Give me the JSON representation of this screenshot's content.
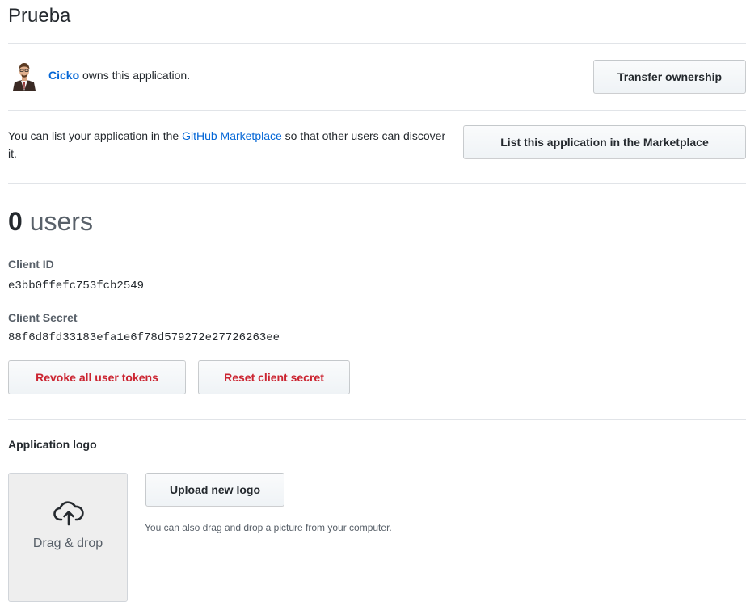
{
  "app": {
    "title": "Prueba"
  },
  "owner": {
    "name": "Cicko",
    "suffix": " owns this application.",
    "transfer_button": "Transfer ownership"
  },
  "marketplace": {
    "text_before": "You can list your application in the ",
    "link_text": "GitHub Marketplace",
    "text_after": " so that other users can discover it.",
    "button": "List this application in the Marketplace"
  },
  "users": {
    "count": "0",
    "label": " users"
  },
  "credentials": {
    "client_id_label": "Client ID",
    "client_id_value": "e3bb0ffefc753fcb2549",
    "client_secret_label": "Client Secret",
    "client_secret_value": "88f6d8fd33183efa1e6f78d579272e27726263ee",
    "revoke_button": "Revoke all user tokens",
    "reset_button": "Reset client secret"
  },
  "logo": {
    "heading": "Application logo",
    "dropzone_icon": "cloud-upload-icon",
    "dropzone_label": "Drag & drop",
    "upload_button": "Upload new logo",
    "note": "You can also drag and drop a picture from your computer."
  },
  "colors": {
    "link": "#0366d6",
    "danger": "#cb2431",
    "text": "#24292e",
    "muted": "#586069",
    "border": "#e1e4e8"
  }
}
